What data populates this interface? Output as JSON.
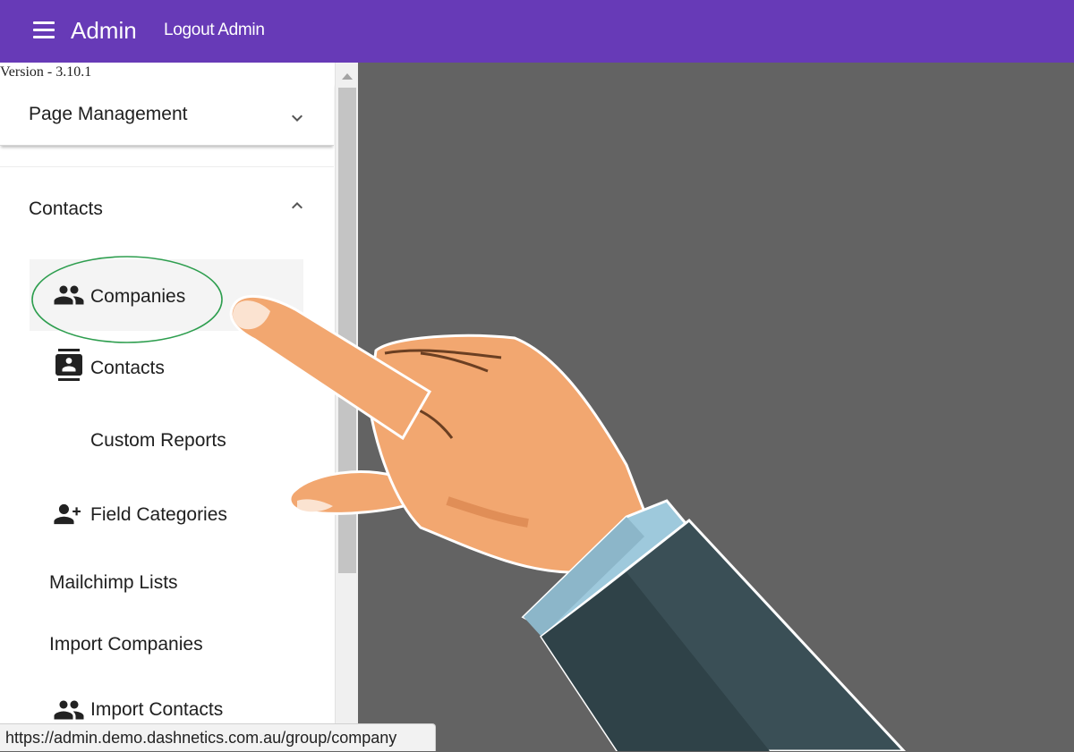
{
  "header": {
    "title": "Admin",
    "logout_label": "Logout Admin",
    "color": "#673ab7",
    "menu_icon": "hamburger-icon"
  },
  "sidebar": {
    "version": "Version - 3.10.1",
    "panels": [
      {
        "label": "Page Management",
        "expanded": false,
        "icon": "chevron-down-icon"
      },
      {
        "label": "Contacts",
        "expanded": true,
        "icon": "chevron-up-icon"
      }
    ],
    "contact_items": [
      {
        "label": "Companies",
        "icon": "people-icon",
        "active": true
      },
      {
        "label": "Contacts",
        "icon": "contact-book-icon",
        "active": false
      },
      {
        "label": "Custom Reports",
        "icon": "",
        "active": false
      },
      {
        "label": "Field Categories",
        "icon": "person-add-icon",
        "active": false
      }
    ],
    "links": [
      {
        "label": "Mailchimp Lists"
      },
      {
        "label": "Import Companies"
      }
    ],
    "import_contacts": {
      "label": "Import Contacts",
      "icon": "people-icon"
    }
  },
  "status_bar": {
    "url": "https://admin.demo.dashnetics.com.au/group/company"
  },
  "overlay": {
    "type": "pointing-hand-illustration",
    "highlight": "green-ellipse",
    "highlight_color": "#2e9e4f"
  }
}
